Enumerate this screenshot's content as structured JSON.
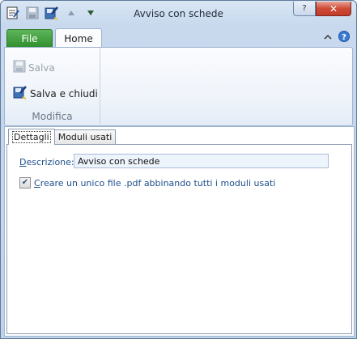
{
  "window": {
    "title": "Avviso con schede"
  },
  "ribbon": {
    "tabs": {
      "file": "File",
      "home": "Home"
    },
    "buttons": {
      "save": "Salva",
      "save_close": "Salva e chiudi"
    },
    "group_label": "Modifica"
  },
  "content": {
    "tabs": [
      "Dettagli",
      "Moduli usati"
    ],
    "description": {
      "label_access_key": "D",
      "label_rest": "escrizione:",
      "value": "Avviso con schede"
    },
    "checkbox": {
      "checked": true,
      "label_access_key": "C",
      "label_rest": "reare un unico file .pdf abbinando tutti i moduli usati"
    }
  },
  "colors": {
    "file_tab": "#2f8f2c",
    "close_button": "#cf4b37",
    "label_text": "#1e4e8c"
  },
  "icons": [
    "app-icon",
    "save-icon",
    "save-close-icon",
    "arrow-up-icon",
    "arrow-down-icon",
    "help-icon",
    "minimize-ribbon-icon"
  ]
}
